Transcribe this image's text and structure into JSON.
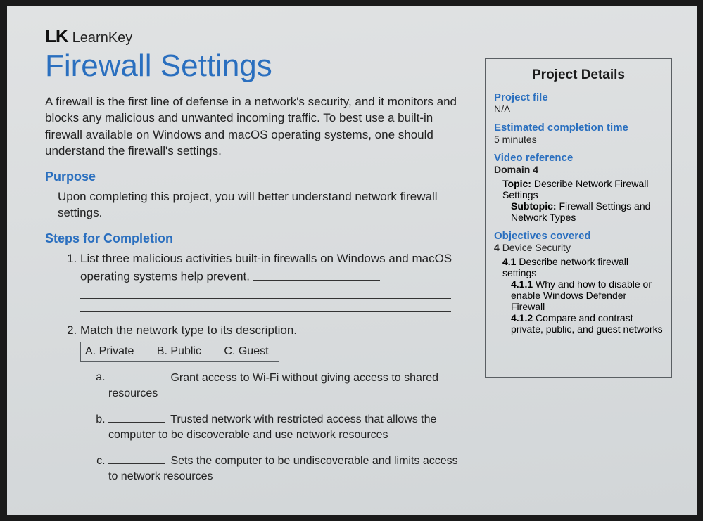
{
  "brand": {
    "mark": "LK",
    "name": "LearnKey"
  },
  "title": "Firewall Settings",
  "intro": "A firewall is the first line of defense in a network's security, and it monitors and blocks any malicious and unwanted incoming traffic. To best use a built-in firewall available on Windows and macOS operating systems, one should understand the firewall's settings.",
  "purpose": {
    "heading": "Purpose",
    "body": "Upon completing this project, you will better understand network firewall settings."
  },
  "steps_heading": "Steps for Completion",
  "steps": [
    {
      "text_before": "List three malicious activities built-in firewalls on Windows and macOS operating systems help prevent. ",
      "has_inline_blank": true,
      "extra_lines": 2
    },
    {
      "text_before": "Match the network type to its description.",
      "options": [
        "A. Private",
        "B. Public",
        "C. Guest"
      ],
      "subitems": [
        {
          "after": "Grant access to Wi-Fi without giving access to shared resources"
        },
        {
          "after": "Trusted network with restricted access that allows the computer to be discoverable and use network resources"
        },
        {
          "after": "Sets the computer to be undiscoverable and limits access to network resources"
        }
      ]
    }
  ],
  "sidebar": {
    "title": "Project Details",
    "project_file": {
      "label": "Project file",
      "value": "N/A"
    },
    "est_time": {
      "label": "Estimated completion time",
      "value": "5 minutes"
    },
    "video_ref": {
      "label": "Video reference",
      "domain": "Domain 4",
      "topic_label": "Topic:",
      "topic": "Describe Network Firewall Settings",
      "subtopic_label": "Subtopic:",
      "subtopic": "Firewall Settings and Network Types"
    },
    "objectives": {
      "label": "Objectives covered",
      "l1_num": "4",
      "l1": "Device Security",
      "l2_num": "4.1",
      "l2": "Describe network firewall settings",
      "l3a_num": "4.1.1",
      "l3a": "Why and how to disable or enable Windows Defender Firewall",
      "l3b_num": "4.1.2",
      "l3b": "Compare and contrast private, public, and guest networks"
    }
  }
}
